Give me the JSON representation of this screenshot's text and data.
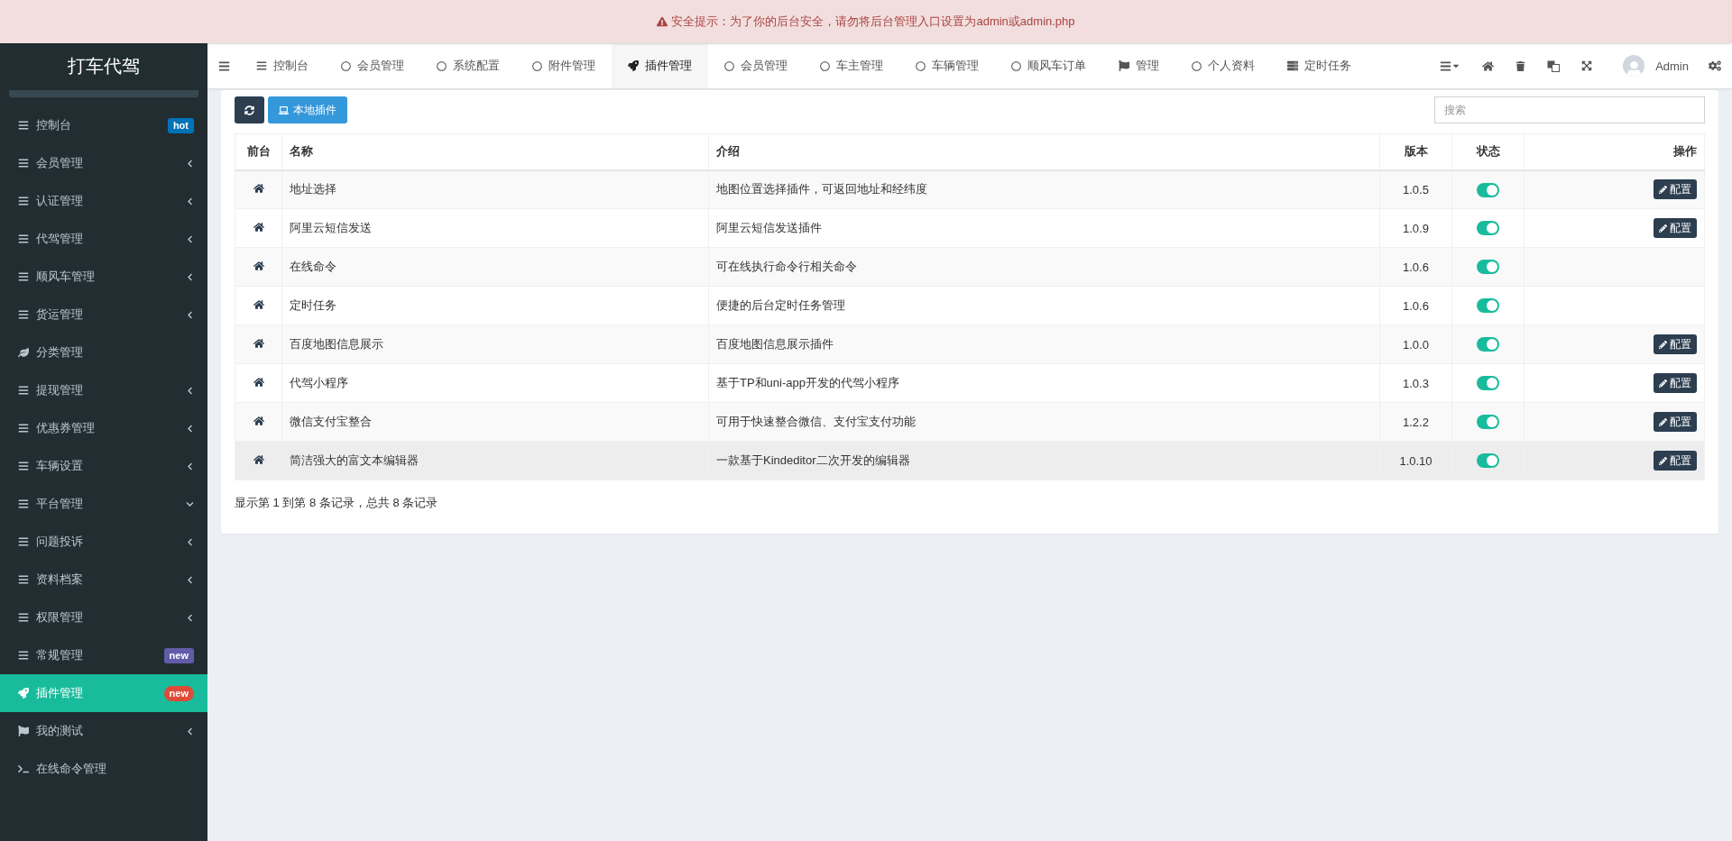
{
  "alert": {
    "text": "安全提示：为了你的后台安全，请勿将后台管理入口设置为admin或admin.php"
  },
  "sidebar": {
    "logo": "打车代驾",
    "items": [
      {
        "label": "控制台",
        "kind": "list",
        "badge": {
          "text": "hot",
          "color": "#0073b7"
        },
        "selected": false
      },
      {
        "label": "会员管理",
        "kind": "list",
        "expanded": false,
        "selected": false
      },
      {
        "label": "认证管理",
        "kind": "list",
        "expanded": false,
        "selected": false
      },
      {
        "label": "代驾管理",
        "kind": "list",
        "expanded": false,
        "selected": false
      },
      {
        "label": "顺风车管理",
        "kind": "list",
        "expanded": false,
        "selected": false
      },
      {
        "label": "货运管理",
        "kind": "list",
        "expanded": false,
        "selected": false
      },
      {
        "label": "分类管理",
        "kind": "leaf",
        "selected": false
      },
      {
        "label": "提现管理",
        "kind": "list",
        "expanded": false,
        "selected": false
      },
      {
        "label": "优惠券管理",
        "kind": "list",
        "expanded": false,
        "selected": false
      },
      {
        "label": "车辆设置",
        "kind": "list",
        "expanded": false,
        "selected": false
      },
      {
        "label": "平台管理",
        "kind": "list",
        "expanded": true,
        "selected": false
      },
      {
        "label": "问题投诉",
        "kind": "list",
        "expanded": false,
        "selected": false
      },
      {
        "label": "资料档案",
        "kind": "list",
        "expanded": false,
        "selected": false
      },
      {
        "label": "权限管理",
        "kind": "list",
        "expanded": false,
        "selected": false
      },
      {
        "label": "常规管理",
        "kind": "list",
        "badge": {
          "text": "new",
          "color": "#605ca8"
        },
        "selected": false
      },
      {
        "label": "插件管理",
        "kind": "rocket",
        "badge": {
          "text": "new",
          "color": "#dd4b39"
        },
        "selected": true
      },
      {
        "label": "我的测试",
        "kind": "flag",
        "expanded": false,
        "selected": false
      },
      {
        "label": "在线命令管理",
        "kind": "terminal",
        "selected": false
      }
    ]
  },
  "tabs": [
    {
      "label": "控制台",
      "kind": "list",
      "selected": false
    },
    {
      "label": "会员管理",
      "kind": "circle",
      "selected": false
    },
    {
      "label": "系统配置",
      "kind": "circle",
      "selected": false
    },
    {
      "label": "附件管理",
      "kind": "circle",
      "selected": false
    },
    {
      "label": "插件管理",
      "kind": "rocket",
      "selected": true
    },
    {
      "label": "会员管理",
      "kind": "circle",
      "selected": false
    },
    {
      "label": "车主管理",
      "kind": "circle",
      "selected": false
    },
    {
      "label": "车辆管理",
      "kind": "circle",
      "selected": false
    },
    {
      "label": "顺风车订单",
      "kind": "circle",
      "selected": false
    },
    {
      "label": "管理",
      "kind": "flag",
      "selected": false
    },
    {
      "label": "个人资料",
      "kind": "circle",
      "selected": false
    },
    {
      "label": "定时任务",
      "kind": "server",
      "selected": false
    }
  ],
  "user": {
    "name": "Admin"
  },
  "toolbar": {
    "local_button": "本地插件",
    "search": {
      "placeholder": "搜索"
    }
  },
  "table": {
    "columns": [
      "前台",
      "名称",
      "介绍",
      "版本",
      "状态",
      "操作"
    ],
    "rows": [
      {
        "name": "地址选择",
        "intro": "地图位置选择插件，可返回地址和经纬度",
        "version": "1.0.5",
        "on": true,
        "action": "配置",
        "highlighted": false
      },
      {
        "name": "阿里云短信发送",
        "intro": "阿里云短信发送插件",
        "version": "1.0.9",
        "on": true,
        "action": "配置",
        "highlighted": false
      },
      {
        "name": "在线命令",
        "intro": "可在线执行命令行相关命令",
        "version": "1.0.6",
        "on": true,
        "highlighted": false
      },
      {
        "name": "定时任务",
        "intro": "便捷的后台定时任务管理",
        "version": "1.0.6",
        "on": true,
        "highlighted": false
      },
      {
        "name": "百度地图信息展示",
        "intro": "百度地图信息展示插件",
        "version": "1.0.0",
        "on": true,
        "action": "配置",
        "highlighted": false
      },
      {
        "name": "代驾小程序",
        "intro": "基于TP和uni-app开发的代驾小程序",
        "version": "1.0.3",
        "on": true,
        "action": "配置",
        "highlighted": false
      },
      {
        "name": "微信支付宝整合",
        "intro": "可用于快速整合微信、支付宝支付功能",
        "version": "1.2.2",
        "on": true,
        "action": "配置",
        "highlighted": false
      },
      {
        "name": "简洁强大的富文本编辑器",
        "intro": "一款基于Kindeditor二次开发的编辑器",
        "version": "1.0.10",
        "on": true,
        "action": "配置",
        "highlighted": true
      }
    ]
  },
  "pagination": {
    "summary": "显示第 1 到第 8 条记录，总共 8 条记录"
  }
}
